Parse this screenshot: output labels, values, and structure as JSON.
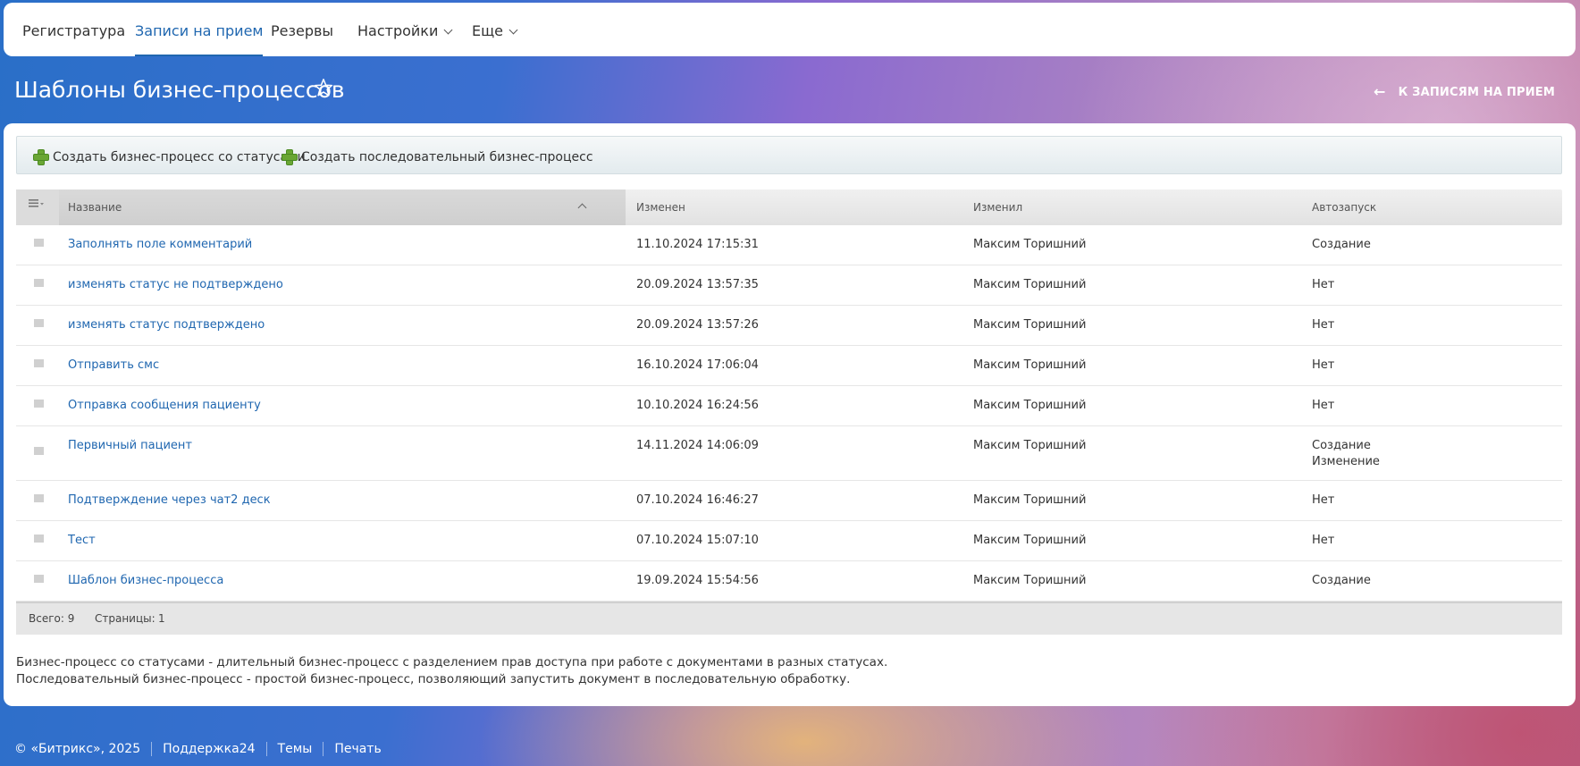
{
  "nav": {
    "items": [
      {
        "label": "Регистратура"
      },
      {
        "label": "Записи на прием"
      },
      {
        "label": "Резервы"
      },
      {
        "label": "Настройки"
      },
      {
        "label": "Еще"
      }
    ],
    "active": "Записи на прием"
  },
  "header": {
    "title": "Шаблоны бизнес-процессов",
    "back_label": "К ЗАПИСЯМ НА ПРИЕМ"
  },
  "toolbar": {
    "create_status_label": "Создать бизнес-процесс со статусами",
    "create_sequential_label": "Создать последовательный бизнес-процесс"
  },
  "grid": {
    "columns": [
      "Название",
      "Изменен",
      "Изменил",
      "Автозапуск"
    ],
    "rows": [
      {
        "name": "Заполнять поле комментарий",
        "modified": "11.10.2024 17:15:31",
        "author": "Максим Торишний",
        "autostart": [
          "Создание"
        ]
      },
      {
        "name": "изменять статус не подтверждено",
        "modified": "20.09.2024 13:57:35",
        "author": "Максим Торишний",
        "autostart": [
          "Нет"
        ]
      },
      {
        "name": "изменять статус подтверждено",
        "modified": "20.09.2024 13:57:26",
        "author": "Максим Торишний",
        "autostart": [
          "Нет"
        ]
      },
      {
        "name": "Отправить смс",
        "modified": "16.10.2024 17:06:04",
        "author": "Максим Торишний",
        "autostart": [
          "Нет"
        ]
      },
      {
        "name": "Отправка сообщения пациенту",
        "modified": "10.10.2024 16:24:56",
        "author": "Максим Торишний",
        "autostart": [
          "Нет"
        ]
      },
      {
        "name": "Первичный пациент",
        "modified": "14.11.2024 14:06:09",
        "author": "Максим Торишний",
        "autostart": [
          "Создание",
          "Изменение"
        ]
      },
      {
        "name": "Подтверждение через чат2 деск",
        "modified": "07.10.2024 16:46:27",
        "author": "Максим Торишний",
        "autostart": [
          "Нет"
        ]
      },
      {
        "name": "Тест",
        "modified": "07.10.2024 15:07:10",
        "author": "Максим Торишний",
        "autostart": [
          "Нет"
        ]
      },
      {
        "name": "Шаблон бизнес-процесса",
        "modified": "19.09.2024 15:54:56",
        "author": "Максим Торишний",
        "autostart": [
          "Создание"
        ]
      }
    ],
    "footer": {
      "total_label": "Всего: 9",
      "pages_label": "Страницы:",
      "pages_value": "1"
    }
  },
  "notes": [
    "Бизнес-процесс со статусами - длительный бизнес-процесс с разделением прав доступа при работе с документами в разных статусах.",
    "Последовательный бизнес-процесс - простой бизнес-процесс, позволяющий запустить документ в последовательную обработку."
  ],
  "footer": {
    "copyright": "© «Битрикс», 2025",
    "links": [
      "Поддержка24",
      "Темы",
      "Печать"
    ]
  }
}
